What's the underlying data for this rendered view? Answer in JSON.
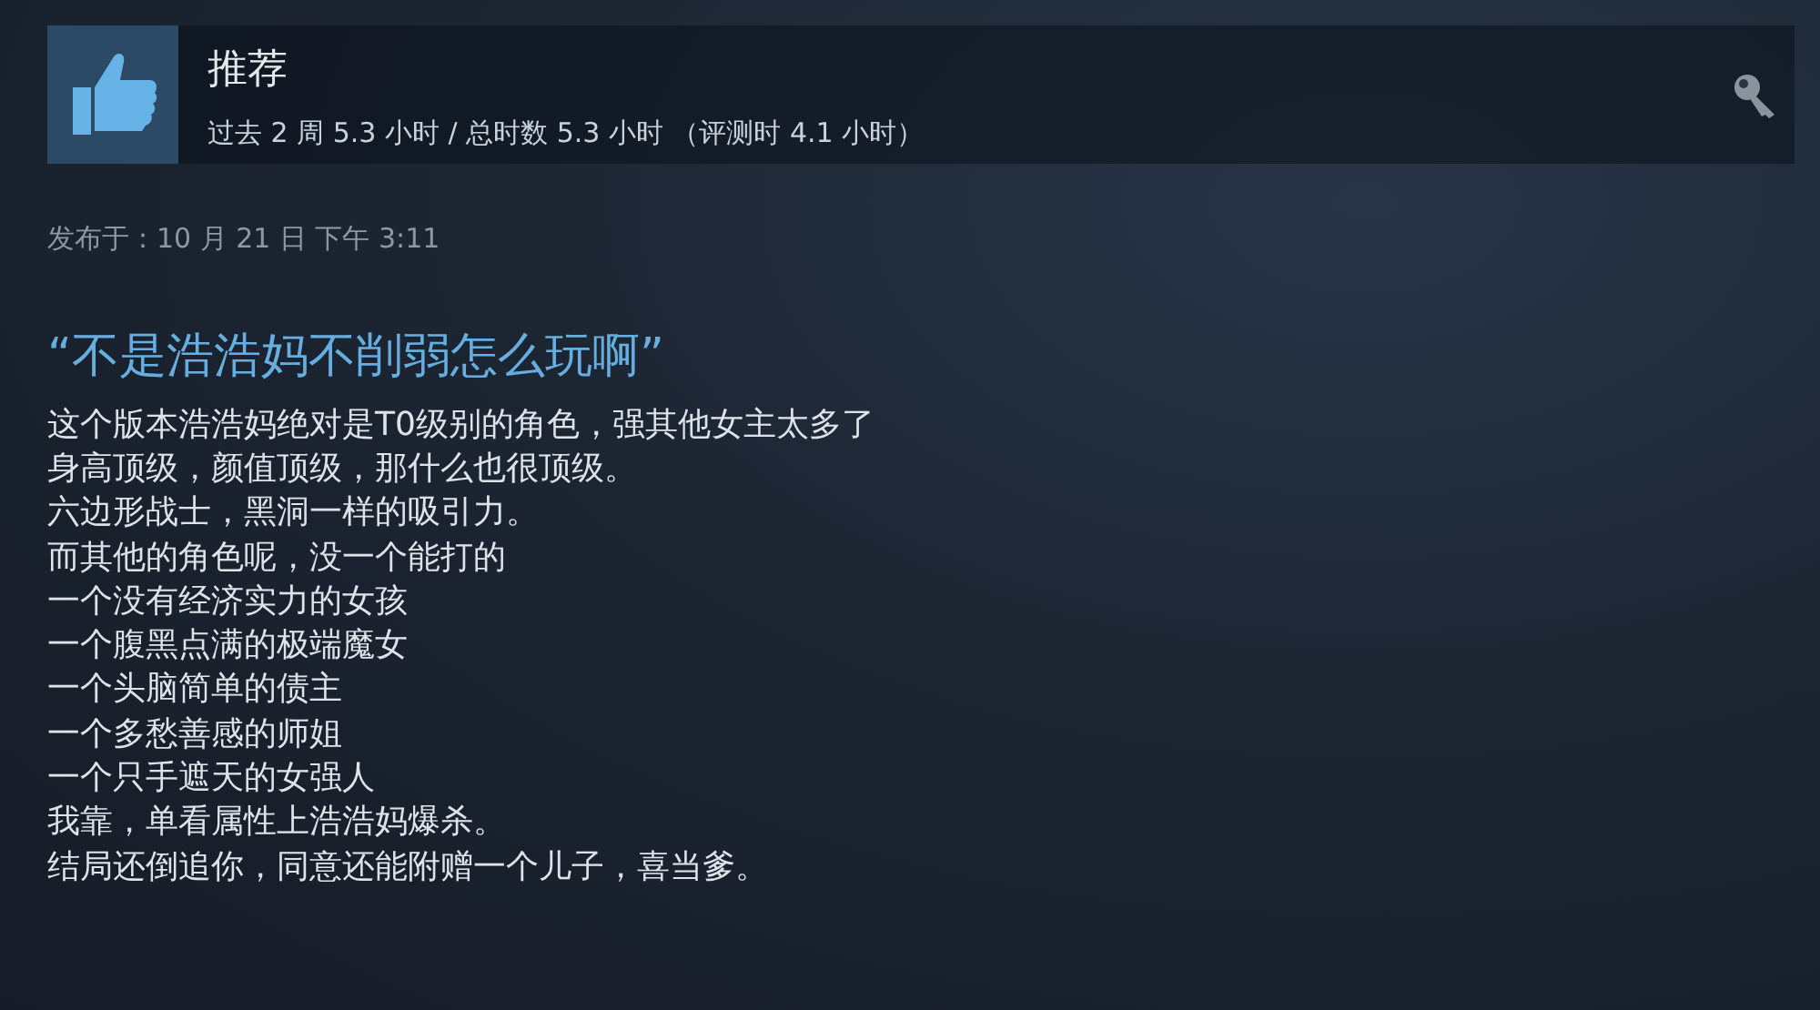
{
  "review": {
    "recommended": true,
    "verdict": "推荐",
    "playtime": "过去 2 周 5.3 小时 / 总时数 5.3 小时 （评测时 4.1 小时）",
    "posted": "发布于：10 月 21 日 下午 3:11",
    "title": "“不是浩浩妈不削弱怎么玩啊”",
    "lines": [
      "这个版本浩浩妈绝对是T0级别的角色，强其他女主太多了",
      "身高顶级，颜值顶级，那什么也很顶级。",
      "六边形战士，黑洞一样的吸引力。",
      "而其他的角色呢，没一个能打的",
      "一个没有经济实力的女孩",
      "一个腹黑点满的极端魔女",
      "一个头脑简单的债主",
      "一个多愁善感的师姐",
      "一个只手遮天的女强人",
      "我靠，单看属性上浩浩妈爆杀。",
      "结局还倒追你，同意还能附赠一个儿子，喜当爹。"
    ]
  }
}
